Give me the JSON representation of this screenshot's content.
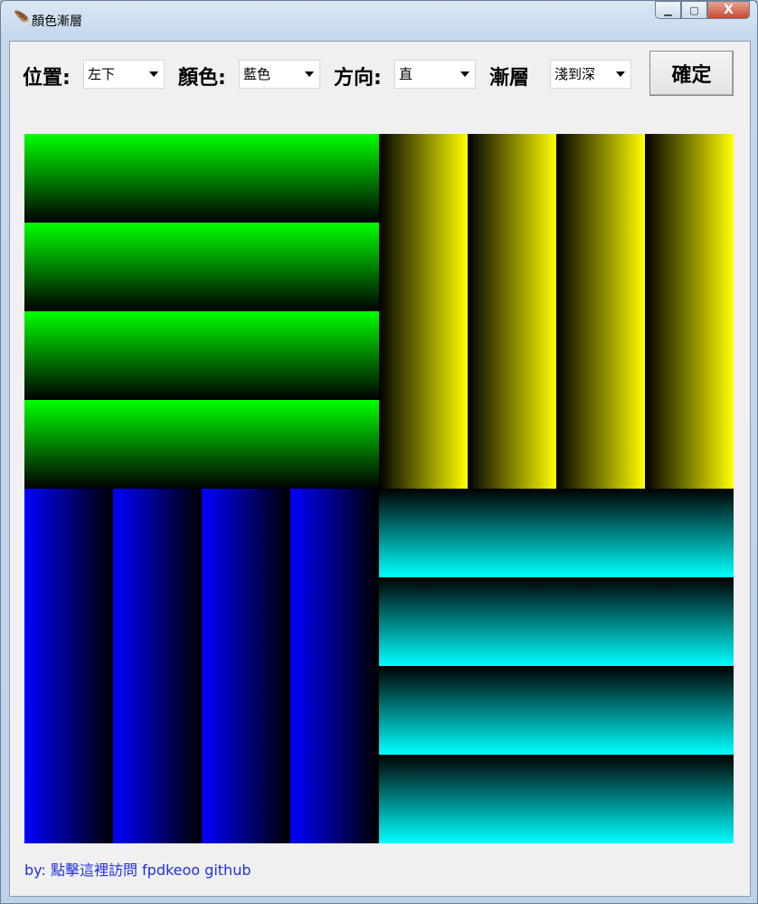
{
  "window": {
    "title": "顏色漸層",
    "icon": "feather-icon"
  },
  "toolbar": {
    "position_label": "位置:",
    "position_value": "左下",
    "color_label": "顏色:",
    "color_value": "藍色",
    "direction_label": "方向:",
    "direction_value": "直",
    "gradient_label": "漸層",
    "gradient_value": "淺到深",
    "confirm_label": "確定"
  },
  "canvas": {
    "quadrants": [
      {
        "position": "top-left",
        "color": "#00ff00",
        "direction": "horizontal-strips",
        "strips": 4
      },
      {
        "position": "top-right",
        "color": "#ffff00",
        "direction": "vertical-strips",
        "strips": 4
      },
      {
        "position": "bottom-left",
        "color": "#0000ff",
        "direction": "vertical-strips",
        "strips": 4
      },
      {
        "position": "bottom-right",
        "color": "#00ffff",
        "direction": "horizontal-strips",
        "strips": 4
      }
    ]
  },
  "footer": {
    "link": "by: 點擊這裡訪問 fpdkeoo github"
  }
}
